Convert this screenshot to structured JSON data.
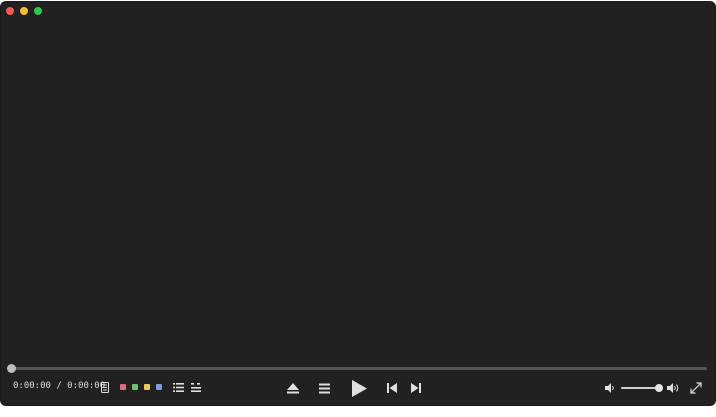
{
  "player": {
    "time_display": "0:00:00 / 0:00:00",
    "progress_fraction": 0,
    "volume_fraction": 1
  },
  "tags": [
    {
      "name": "red",
      "color": "#e06c7a"
    },
    {
      "name": "green",
      "color": "#6cc070"
    },
    {
      "name": "yellow",
      "color": "#e6cf5a"
    },
    {
      "name": "blue",
      "color": "#7b9ee0"
    }
  ],
  "icons": [
    "subtitles-icon",
    "list-icon",
    "chapters-icon",
    "eject-icon",
    "menu-icon",
    "play-icon",
    "previous-icon",
    "next-icon",
    "volume-low-icon",
    "volume-high-icon",
    "fullscreen-icon"
  ],
  "colors": {
    "window_bg": "#212121",
    "text": "#dddddd",
    "icon": "#e0e0e0"
  }
}
